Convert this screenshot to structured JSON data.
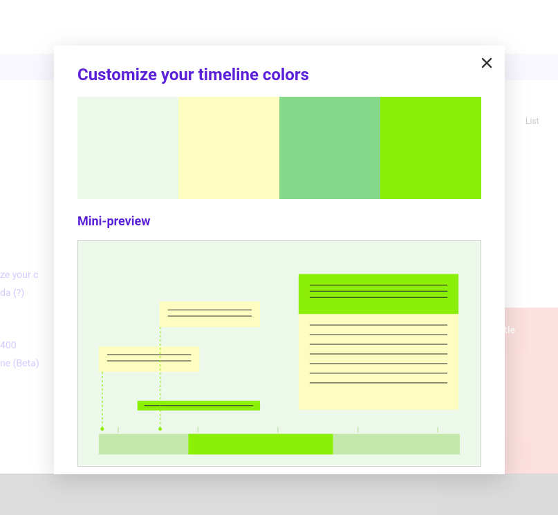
{
  "background": {
    "right_card_text": "e title",
    "left_items": [
      "ze your c",
      "da  (?)",
      "400",
      "ne (Beta)"
    ],
    "list_label": "List"
  },
  "modal": {
    "title": "Customize your timeline colors",
    "subheading": "Mini-preview",
    "close_label": "Close",
    "swatches": [
      {
        "name": "pale-mint",
        "color": "#ecf8e9"
      },
      {
        "name": "pale-yellow",
        "color": "#fdfdc1"
      },
      {
        "name": "soft-green",
        "color": "#86d88b"
      },
      {
        "name": "neon-green",
        "color": "#8bef08"
      }
    ],
    "preview": {
      "background": "#ecf8e9",
      "card_fill": "#fdfdc1",
      "accent_fill": "#8bef08",
      "bar_fill": "#c2e9ab",
      "line_color": "#2c2c2c",
      "dashed_color": "#8bef08"
    }
  }
}
